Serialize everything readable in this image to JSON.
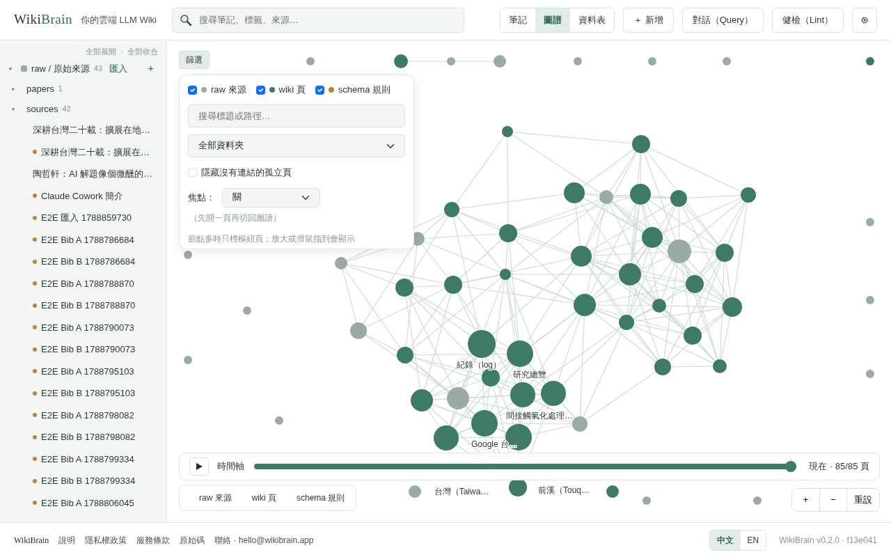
{
  "header": {
    "logo": [
      "Wiki",
      "Brain"
    ],
    "tagline": "你的雲端 LLM Wiki",
    "search": {
      "placeholder": "搜尋筆記、標籤、來源…"
    },
    "views": [
      {
        "label": "筆記",
        "selected": false
      },
      {
        "label": "圖譜",
        "selected": true
      },
      {
        "label": "資料表",
        "selected": false
      }
    ],
    "buttons": [
      "＋ 新增",
      "對話（Query）",
      "健檢（Lint）"
    ]
  },
  "sidebar": {
    "actions": [
      "全部展開",
      "全部收合"
    ],
    "separator": "·",
    "tree": [
      {
        "label": "raw / 原始來源",
        "count": "43",
        "expanded": true,
        "action": "匯入",
        "add": "+",
        "children": [
          {
            "label": "papers",
            "count": "1",
            "expanded": false
          },
          {
            "label": "sources",
            "count": "42",
            "expanded": true,
            "children": [
              {
                "label": "深耕台灣二十載：擴展在地…",
                "kind": "plain"
              },
              {
                "label": "深耕台灣二十載：擴展在…",
                "kind": "schema"
              },
              {
                "label": "陶哲軒：AI 解題像個微醺的…",
                "kind": "plain"
              },
              {
                "label": "Claude Cowork 簡介",
                "kind": "schema"
              },
              {
                "label": "E2E 匯入 1788859730",
                "kind": "schema"
              },
              {
                "label": "E2E Bib A 1788786684",
                "kind": "schema"
              },
              {
                "label": "E2E Bib B 1788786684",
                "kind": "schema"
              },
              {
                "label": "E2E Bib A 1788788870",
                "kind": "schema"
              },
              {
                "label": "E2E Bib B 1788788870",
                "kind": "schema"
              },
              {
                "label": "E2E Bib A 1788790073",
                "kind": "schema"
              },
              {
                "label": "E2E Bib B 1788790073",
                "kind": "schema"
              },
              {
                "label": "E2E Bib A 1788795103",
                "kind": "schema"
              },
              {
                "label": "E2E Bib B 1788795103",
                "kind": "schema"
              },
              {
                "label": "E2E Bib A 1788798082",
                "kind": "schema"
              },
              {
                "label": "E2E Bib B 1788798082",
                "kind": "schema"
              },
              {
                "label": "E2E Bib A 1788799334",
                "kind": "schema"
              },
              {
                "label": "E2E Bib B 1788799334",
                "kind": "schema"
              },
              {
                "label": "E2E Bib A 1788806045",
                "kind": "schema"
              }
            ]
          }
        ]
      }
    ]
  },
  "filter": {
    "button": "篩選",
    "types": [
      {
        "label": "raw 來源",
        "checked": true,
        "color": "#9aaba4"
      },
      {
        "label": "wiki 頁",
        "checked": true,
        "color": "#3d7a68"
      },
      {
        "label": "schema 規則",
        "checked": true,
        "color": "#b8843a"
      }
    ],
    "search": {
      "placeholder": "搜尋標題或路徑…"
    },
    "folder": {
      "value": "全部資料夾"
    },
    "hide_orphans": {
      "label": "隱藏沒有連結的孤立頁",
      "checked": false
    },
    "focus": {
      "label": "焦點：",
      "value": "關"
    },
    "hint": "（先開一頁再切回圖譜）",
    "note": "節點多時只標樞紐頁；放大或滑鼠指到會顯示"
  },
  "graph": {
    "nodes": [
      {
        "kind": "raw"
      },
      {
        "kind": "raw"
      },
      {
        "kind": "raw"
      },
      {
        "kind": "raw"
      },
      {
        "kind": "raw"
      },
      {
        "kind": "wiki"
      },
      {
        "kind": "raw"
      },
      {
        "kind": "raw"
      },
      {
        "kind": "raw"
      },
      {
        "kind": "raw"
      },
      {
        "kind": "raw"
      },
      {
        "kind": "raw"
      },
      {
        "kind": "raw"
      },
      {
        "kind": "raw"
      },
      {
        "kind": "raw"
      },
      {
        "kind": "wiki"
      },
      {
        "kind": "raw"
      },
      {
        "kind": "wiki"
      },
      {
        "kind": "wiki"
      },
      {
        "kind": "wiki"
      },
      {
        "kind": "raw"
      },
      {
        "kind": "wiki"
      },
      {
        "kind": "wiki"
      },
      {
        "kind": "wiki"
      },
      {
        "kind": "wiki"
      },
      {
        "kind": "wiki"
      },
      {
        "kind": "wiki"
      },
      {
        "kind": "raw"
      },
      {
        "kind": "wiki"
      },
      {
        "kind": "raw"
      },
      {
        "kind": "raw"
      },
      {
        "kind": "wiki"
      },
      {
        "kind": "wiki"
      },
      {
        "kind": "wiki"
      },
      {
        "kind": "wiki"
      },
      {
        "kind": "wiki"
      },
      {
        "kind": "wiki"
      },
      {
        "kind": "wiki"
      },
      {
        "kind": "wiki"
      },
      {
        "kind": "wiki"
      },
      {
        "kind": "wiki"
      },
      {
        "kind": "raw"
      },
      {
        "kind": "wiki"
      },
      {
        "kind": "wiki",
        "label": "紀錄（log）"
      },
      {
        "kind": "wiki",
        "label": "研究總覽"
      },
      {
        "kind": "wiki"
      },
      {
        "kind": "wiki"
      },
      {
        "kind": "wiki"
      },
      {
        "kind": "wiki"
      },
      {
        "kind": "wiki",
        "label": "間接觸氧化處理…"
      },
      {
        "kind": "wiki"
      },
      {
        "kind": "wiki"
      },
      {
        "kind": "raw"
      },
      {
        "kind": "raw"
      },
      {
        "kind": "wiki",
        "label": "Google 台…"
      },
      {
        "kind": "wiki"
      },
      {
        "kind": "wiki"
      },
      {
        "kind": "raw",
        "label": "台灣（Taiwa…"
      },
      {
        "kind": "wiki",
        "label": "前溪（Touq…"
      },
      {
        "kind": "wiki"
      }
    ]
  },
  "timeline": {
    "label": "時間軸",
    "level": 1,
    "reading": "現在 · 85/85 頁"
  },
  "legend": [
    "raw 來源",
    "wiki 頁",
    "schema 規則"
  ],
  "zoom": [
    "+",
    "−",
    "重設"
  ],
  "footer": {
    "brand": "WikiBrain",
    "links": [
      "說明",
      "隱私權政策",
      "服務條款",
      "原始碼"
    ],
    "contact": "聯絡 · hello@wikibrain.app",
    "languages": [
      {
        "label": "中文",
        "selected": true
      },
      {
        "label": "EN",
        "selected": false
      }
    ],
    "version": "WikiBrain v0.2.0 · f13e041"
  }
}
